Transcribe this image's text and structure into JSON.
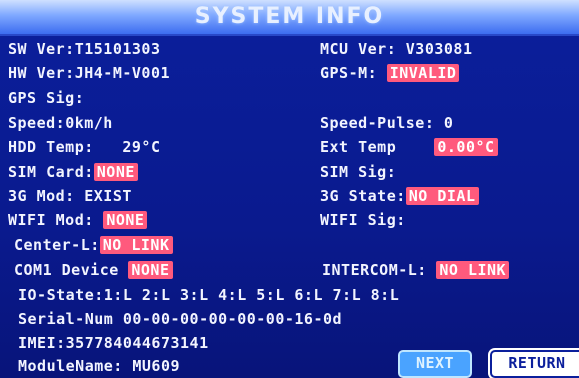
{
  "title": "SYSTEM INFO",
  "left": {
    "sw_ver_label": "SW Ver:",
    "sw_ver": "T15101303",
    "hw_ver_label": "HW Ver:",
    "hw_ver": "JH4-M-V001",
    "gps_sig_label": "GPS Sig:",
    "speed_label": "Speed:",
    "speed": "0km/h",
    "hdd_temp_label": "HDD Temp:",
    "hdd_temp": "29°C",
    "sim_card_label": "SIM Card:",
    "sim_card": "NONE",
    "mod_3g_label": "3G Mod:",
    "mod_3g": "EXIST",
    "wifi_mod_label": "WIFI Mod:",
    "wifi_mod": "NONE",
    "center_label": "Center-L:",
    "center": "NO LINK",
    "com1_label": "COM1 Device",
    "com1": "NONE"
  },
  "right": {
    "mcu_ver_label": "MCU Ver:",
    "mcu_ver": "V303081",
    "gps_m_label": "GPS-M:",
    "gps_m": "INVALID",
    "speed_pulse_label": "Speed-Pulse:",
    "speed_pulse": "0",
    "ext_temp_label": "Ext Temp",
    "ext_temp": "0.00°C",
    "sim_sig_label": "SIM Sig:",
    "state_3g_label": "3G State:",
    "state_3g": "NO DIAL",
    "wifi_sig_label": "WIFI Sig:",
    "intercom_label": "INTERCOM-L:",
    "intercom": "NO LINK"
  },
  "bottom": {
    "io_state": "IO-State:1:L 2:L 3:L 4:L 5:L 6:L 7:L 8:L",
    "serial_label": "Serial-Num",
    "serial": "00-00-00-00-00-00-16-0d",
    "imei": "IMEI:357784044673141",
    "module_label": "ModuleName:",
    "module": "MU609"
  },
  "buttons": {
    "next": "NEXT",
    "return": "RETURN"
  },
  "colors": {
    "background": "#0b1f9c",
    "alert": "#ff5a7d",
    "title_bar": "#7fa8ff"
  }
}
